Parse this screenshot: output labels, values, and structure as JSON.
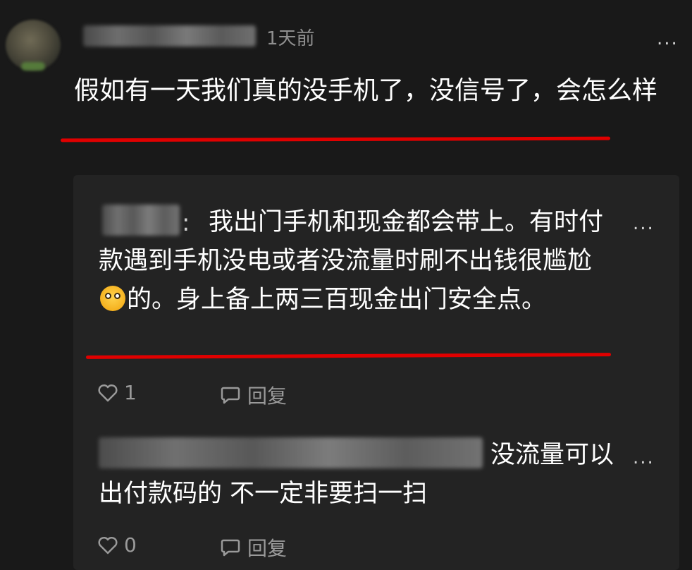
{
  "post": {
    "time": "1天前",
    "text": "假如有一天我们真的没手机了，没信号了，会怎么样",
    "more": "..."
  },
  "replies": [
    {
      "text_part1": "我出门手机和现金都会带上。有时付款遇到手机没电或者没流量时刷不出钱很尴尬",
      "text_part2": "的。身上备上两三百现金出门安全点。",
      "emoji": "flushed-face-emoji",
      "likes": "1",
      "reply_label": "回复",
      "more": "..."
    },
    {
      "text": "没流量可以出付款码的 不一定非要扫一扫",
      "likes": "0",
      "reply_label": "回复",
      "more": "..."
    }
  ],
  "colors": {
    "background": "#191919",
    "reply_box": "#232323",
    "underline": "#e00000",
    "muted_text": "#9a9a9a"
  }
}
